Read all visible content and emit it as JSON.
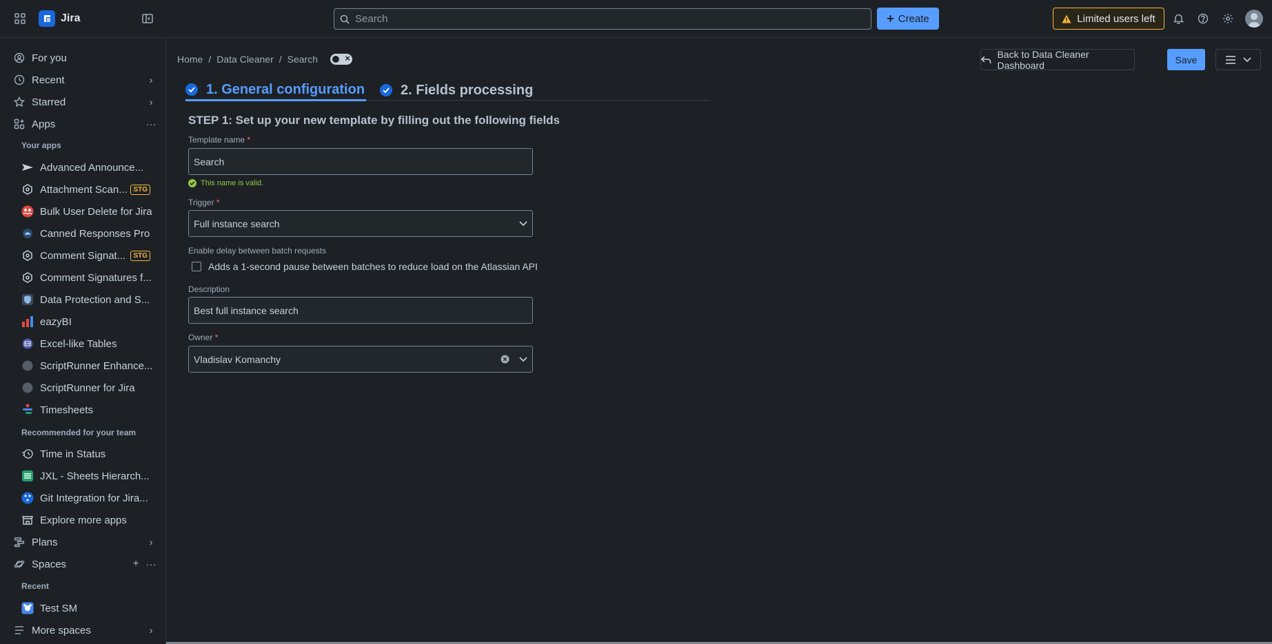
{
  "topbar": {
    "app_name": "Jira",
    "search_placeholder": "Search",
    "create_label": "Create",
    "limited_label": "Limited users left"
  },
  "sidebar": {
    "for_you": "For you",
    "recent": "Recent",
    "starred": "Starred",
    "apps": "Apps",
    "your_apps_heading": "Your apps",
    "apps_list": [
      "Advanced Announce...",
      "Attachment Scan...",
      "Bulk User Delete for Jira",
      "Canned Responses Pro",
      "Comment Signat...",
      "Comment Signatures f...",
      "Data Protection and S...",
      "eazyBI",
      "Excel-like Tables",
      "ScriptRunner Enhance...",
      "ScriptRunner for Jira",
      "Timesheets"
    ],
    "stg_badge": "STG",
    "recommended_heading": "Recommended for your team",
    "recommended": [
      "Time in Status",
      "JXL - Sheets Hierarch...",
      "Git Integration for Jira..."
    ],
    "explore": "Explore more apps",
    "plans": "Plans",
    "spaces": "Spaces",
    "recent_heading": "Recent",
    "recent_space": "Test SM",
    "more_spaces": "More spaces"
  },
  "breadcrumb": {
    "home": "Home",
    "sep": "/",
    "data_cleaner": "Data Cleaner",
    "current": "Search"
  },
  "header_actions": {
    "back_label": "Back to Data Cleaner Dashboard",
    "save_label": "Save"
  },
  "tabs": [
    {
      "label": "1. General configuration"
    },
    {
      "label": "2. Fields processing"
    }
  ],
  "form": {
    "step_title": "STEP 1: Set up your new template by filling out the following fields",
    "template_name_label": "Template name",
    "template_name_value": "Search",
    "valid_msg": "This name is valid.",
    "trigger_label": "Trigger",
    "trigger_value": "Full instance search",
    "delay_label": "Enable delay between batch requests",
    "delay_checkbox_label": "Adds a 1-second pause between batches to reduce load on the Atlassian API",
    "description_label": "Description",
    "description_value": "Best full instance search",
    "owner_label": "Owner",
    "owner_value": "Vladislav Komanchy",
    "required_mark": "*"
  },
  "colors": {
    "accent": "#579dff",
    "background": "#1d2125",
    "warning": "#f5b63a",
    "success": "#94c748"
  }
}
